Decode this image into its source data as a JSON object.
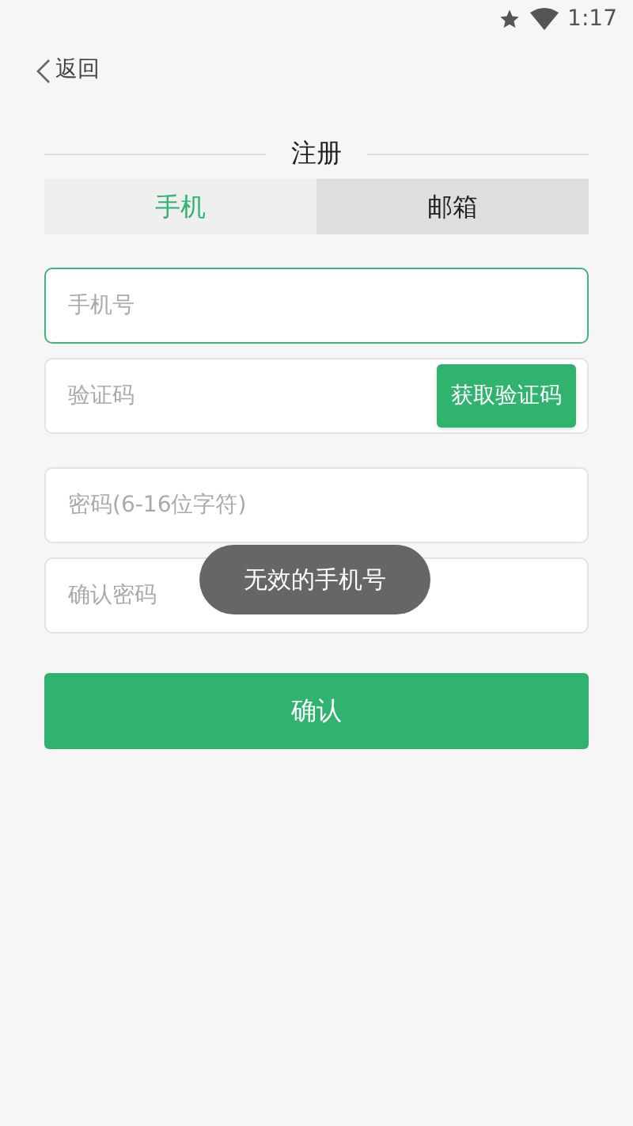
{
  "status_bar": {
    "time": "1:17"
  },
  "back": {
    "label": "返回"
  },
  "title": "注册",
  "tabs": [
    {
      "label": "手机",
      "selected": true
    },
    {
      "label": "邮箱",
      "selected": false
    }
  ],
  "fields": [
    {
      "placeholder": "手机号",
      "focused": true
    },
    {
      "placeholder": "验证码",
      "focused": false,
      "button": "获取验证码"
    },
    {
      "placeholder": "密码(6-16位字符)",
      "focused": false
    },
    {
      "placeholder": "确认密码",
      "focused": false
    }
  ],
  "submit": "确认",
  "toast": "无效的手机号"
}
